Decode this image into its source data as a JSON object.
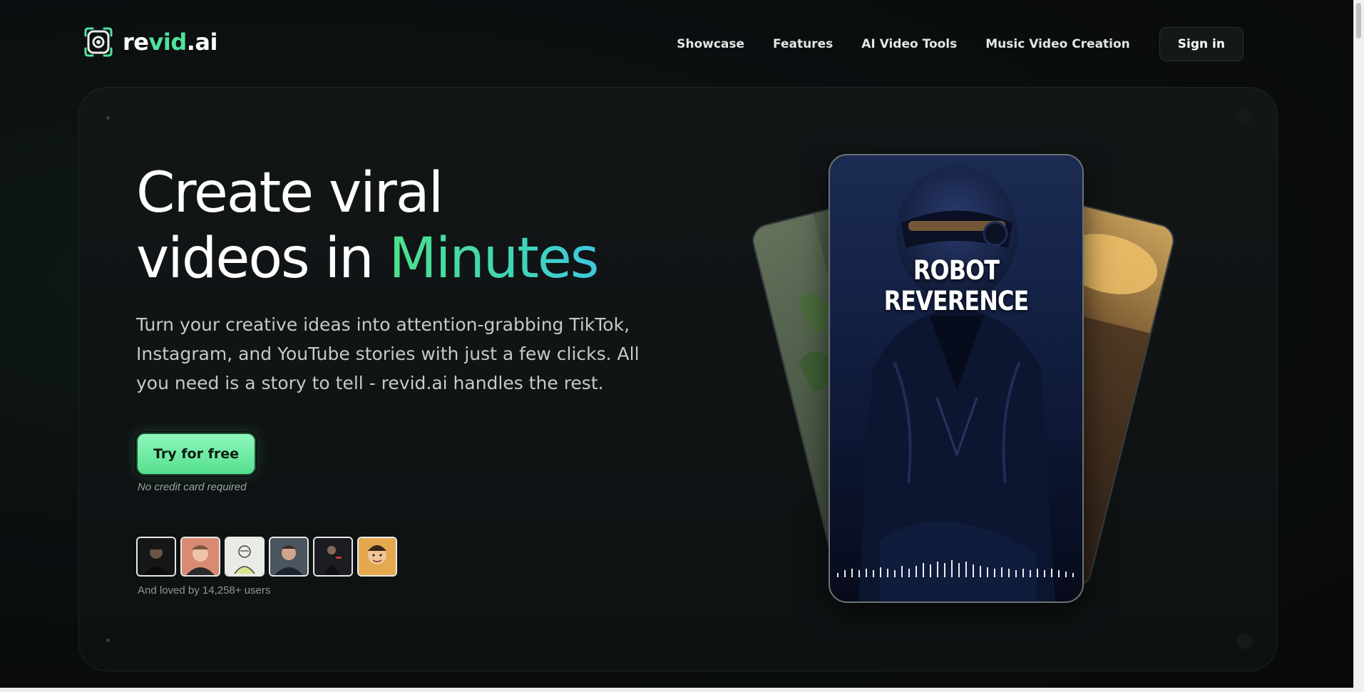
{
  "header": {
    "logo": {
      "text_part1": "re",
      "text_accent": "vid",
      "text_part2": ".ai"
    },
    "nav": [
      {
        "label": "Showcase"
      },
      {
        "label": "Features"
      },
      {
        "label": "AI Video Tools"
      },
      {
        "label": "Music Video Creation"
      }
    ],
    "signin_label": "Sign in"
  },
  "hero": {
    "headline_line1": "Create viral",
    "headline_line2_plain": "videos in ",
    "headline_line2_accent": "Minutes",
    "subtext": "Turn your creative ideas into attention-grabbing TikTok, Instagram, and YouTube stories with just a few clicks. All you need is a story to tell - revid.ai handles the rest.",
    "cta_label": "Try for free",
    "cta_note": "No credit card required",
    "social_proof": "And loved by 14,258+ users"
  },
  "showcase": {
    "phone_title": "ROBOT REVERENCE"
  },
  "colors": {
    "accent": "#4fe39c",
    "background": "#0a0d0e",
    "cta_gradient_top": "#8ff7bb",
    "cta_gradient_bottom": "#55e08f"
  }
}
